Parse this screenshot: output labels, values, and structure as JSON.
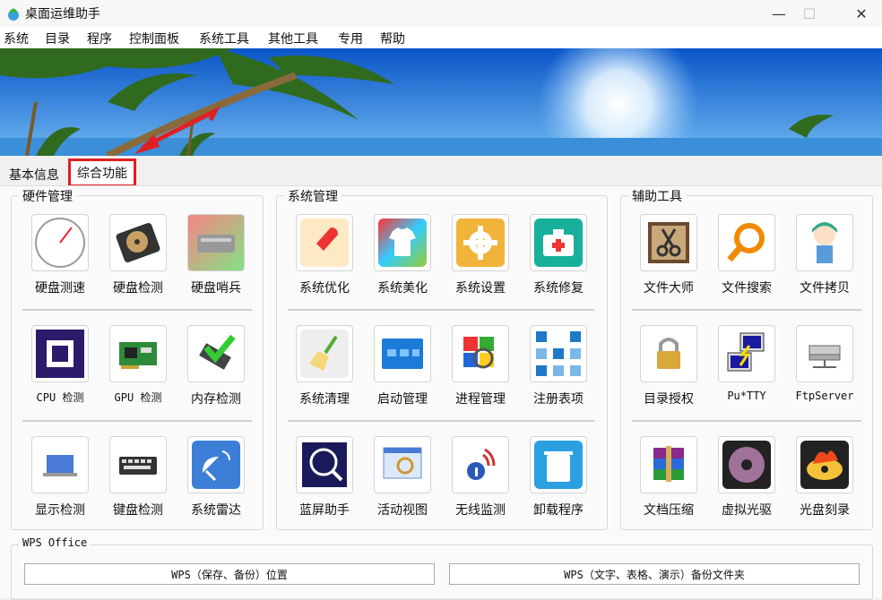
{
  "window": {
    "title": "桌面运维助手",
    "minimize": "—",
    "maximize": "☐",
    "close": "✕"
  },
  "menu": [
    "系统",
    "目录",
    "程序",
    "控制面板",
    "系统工具",
    "其他工具",
    "专用",
    "帮助"
  ],
  "tabs": {
    "basic": "基本信息",
    "active": "综合功能"
  },
  "groups": {
    "hardware": {
      "title": "硬件管理",
      "items": [
        "硬盘测速",
        "硬盘检测",
        "硬盘哨兵",
        "CPU 检测",
        "GPU 检测",
        "内存检测",
        "显示检测",
        "键盘检测",
        "系统雷达"
      ]
    },
    "system": {
      "title": "系统管理",
      "items": [
        "系统优化",
        "系统美化",
        "系统设置",
        "系统修复",
        "系统清理",
        "启动管理",
        "进程管理",
        "注册表项",
        "蓝屏助手",
        "活动视图",
        "无线监测",
        "卸载程序"
      ]
    },
    "aux": {
      "title": "辅助工具",
      "items": [
        "文件大师",
        "文件搜索",
        "文件拷贝",
        "目录授权",
        "Pu*TTY",
        "FtpServer",
        "文档压缩",
        "虚拟光驱",
        "光盘刻录"
      ]
    }
  },
  "wps": {
    "title": "WPS Office",
    "btn1": "WPS（保存、备份）位置",
    "btn2": "WPS（文字、表格、演示）备份文件夹"
  }
}
